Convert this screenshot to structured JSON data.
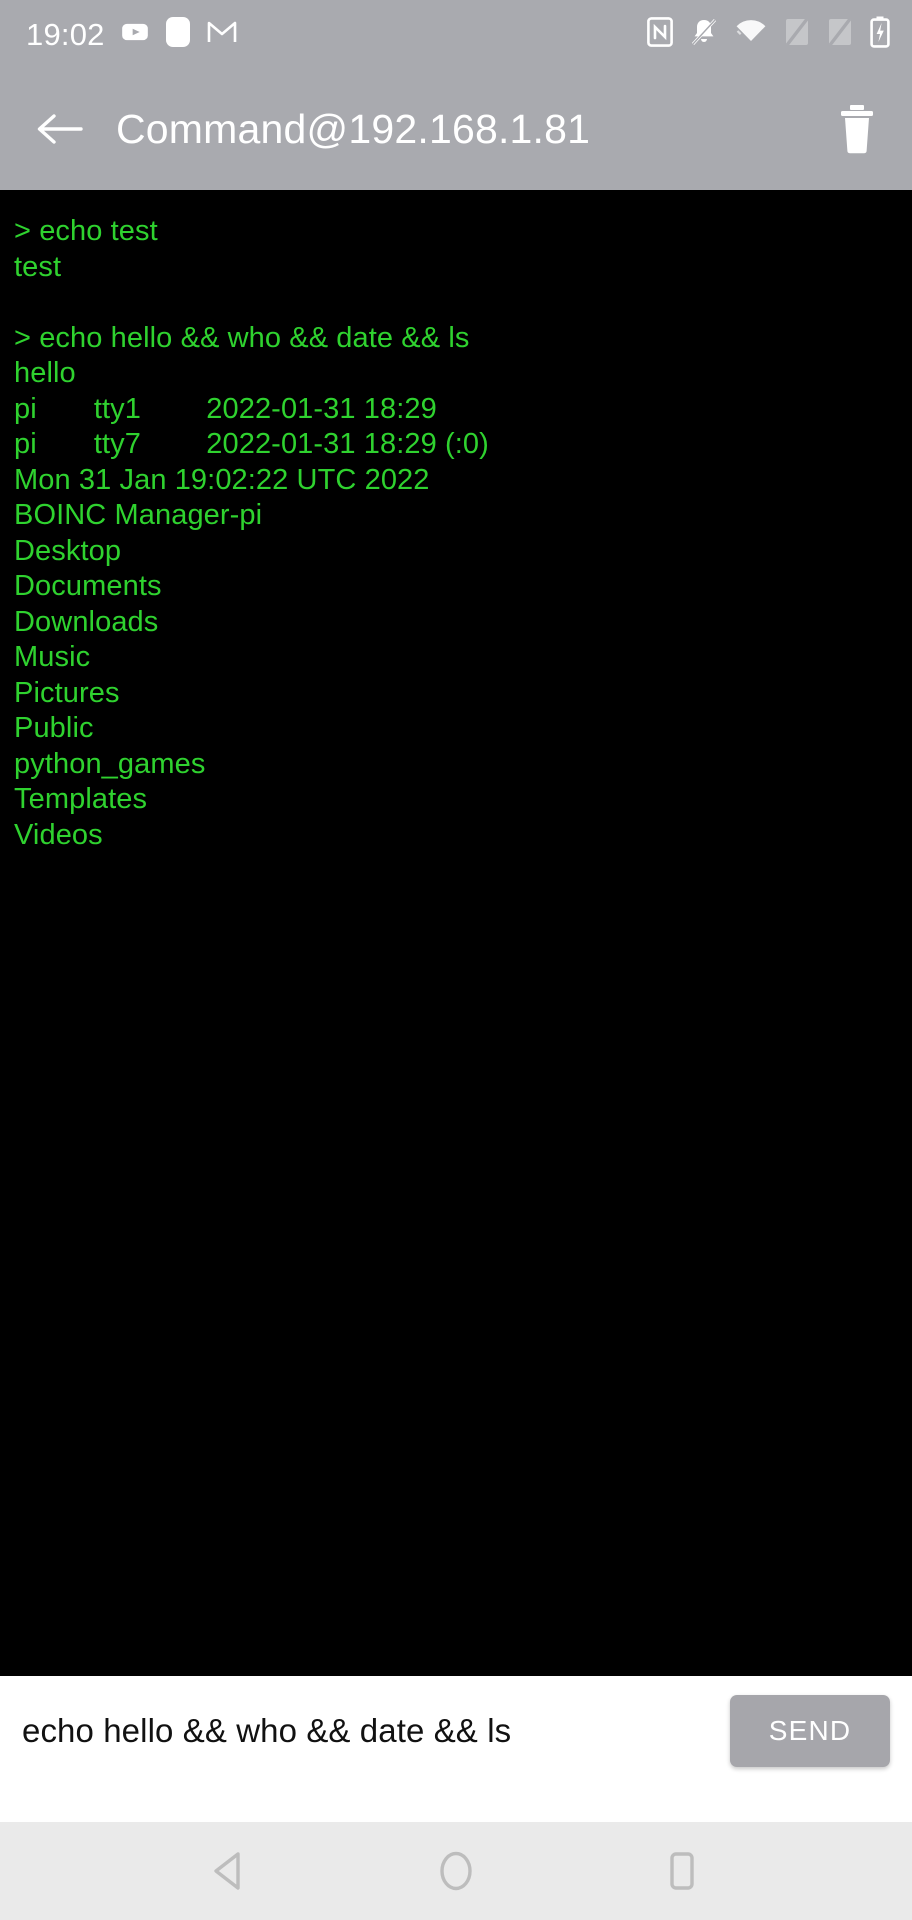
{
  "status_bar": {
    "time": "19:02",
    "left_icons": [
      "youtube-icon",
      "rounded-square-icon",
      "gmail-icon"
    ],
    "right_icons": [
      "nfc-icon",
      "notifications-muted-icon",
      "wifi-icon",
      "signal-off-1-icon",
      "signal-off-2-icon",
      "battery-charging-icon"
    ],
    "background_color": "#A9AAAF",
    "icon_color": "#FFFFFF"
  },
  "app_bar": {
    "title": "Command@192.168.1.81",
    "back_icon": "arrow-left-icon",
    "delete_icon": "trash-icon",
    "background_color": "#A9AAAF",
    "text_color": "#FFFFFF"
  },
  "terminal": {
    "background_color": "#000000",
    "text_color": "#2FD22F",
    "lines": [
      "> echo test",
      "test",
      "",
      "> echo hello && who && date && ls",
      "hello",
      "pi       tty1        2022-01-31 18:29",
      "pi       tty7        2022-01-31 18:29 (:0)",
      "Mon 31 Jan 19:02:22 UTC 2022",
      "BOINC Manager-pi",
      "Desktop",
      "Documents",
      "Downloads",
      "Music",
      "Pictures",
      "Public",
      "python_games",
      "Templates",
      "Videos"
    ]
  },
  "input_bar": {
    "value": "echo hello && who && date && ls",
    "placeholder": "",
    "send_label": "SEND",
    "send_color": "#A6A6AB",
    "background_color": "#FFFFFF"
  },
  "nav_bar": {
    "background_color": "#EAEAEA",
    "icon_color": "#BDBDBD",
    "back_icon": "triangle-back-icon",
    "home_icon": "circle-home-icon",
    "recents_icon": "square-recents-icon"
  }
}
